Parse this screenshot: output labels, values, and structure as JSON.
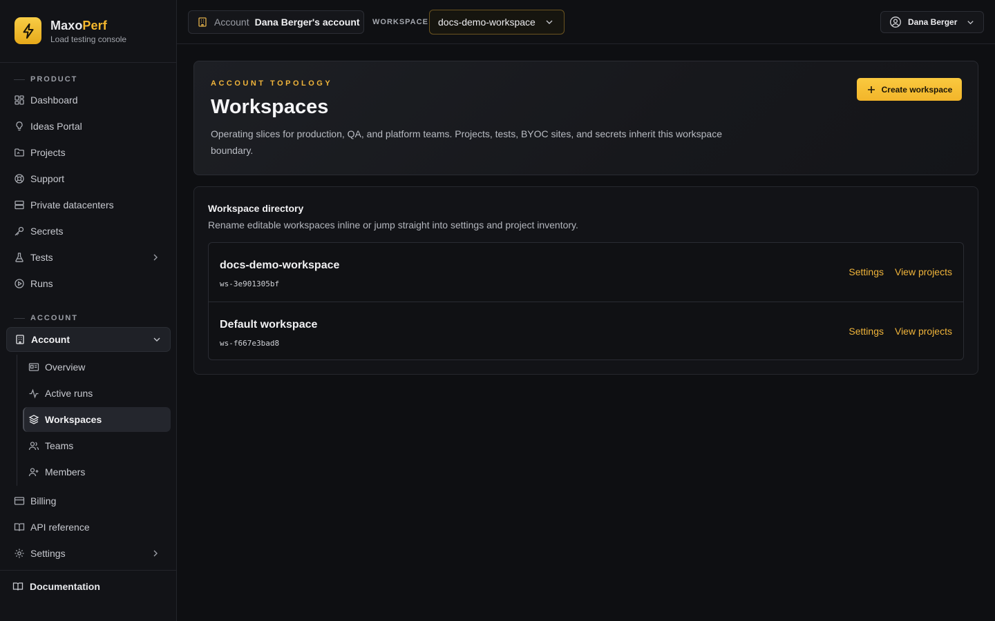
{
  "brand": {
    "name_part1": "Maxo",
    "name_part2": "Perf",
    "subtitle": "Load testing console"
  },
  "sidebar": {
    "product_label": "PRODUCT",
    "account_label": "ACCOUNT",
    "items": [
      {
        "label": "Dashboard",
        "icon": "dashboard-icon"
      },
      {
        "label": "Ideas Portal",
        "icon": "lightbulb-icon"
      },
      {
        "label": "Projects",
        "icon": "folder-icon"
      },
      {
        "label": "Support",
        "icon": "lifebuoy-icon"
      },
      {
        "label": "Private datacenters",
        "icon": "server-icon"
      },
      {
        "label": "Secrets",
        "icon": "key-icon"
      },
      {
        "label": "Tests",
        "icon": "flask-icon"
      },
      {
        "label": "Runs",
        "icon": "play-circle-icon"
      }
    ],
    "account_group": "Account",
    "account_sub": [
      {
        "label": "Overview",
        "icon": "id-card-icon"
      },
      {
        "label": "Active runs",
        "icon": "activity-icon"
      },
      {
        "label": "Workspaces",
        "icon": "layers-icon"
      },
      {
        "label": "Teams",
        "icon": "users-icon"
      },
      {
        "label": "Members",
        "icon": "user-plus-icon"
      }
    ],
    "after_items": [
      {
        "label": "Billing",
        "icon": "credit-card-icon"
      },
      {
        "label": "API reference",
        "icon": "book-icon"
      },
      {
        "label": "Settings",
        "icon": "gear-icon"
      }
    ],
    "documentation": "Documentation"
  },
  "topbar": {
    "account_prefix": "Account",
    "account_name": "Dana Berger's account",
    "workspace_label": "WORKSPACE",
    "workspace_selected": "docs-demo-workspace",
    "user_name": "Dana Berger"
  },
  "hero": {
    "eyebrow": "ACCOUNT TOPOLOGY",
    "title": "Workspaces",
    "description": "Operating slices for production, QA, and platform teams. Projects, tests, BYOC sites, and secrets inherit this workspace boundary.",
    "create_button": "Create workspace"
  },
  "directory": {
    "title": "Workspace directory",
    "description": "Rename editable workspaces inline or jump straight into settings and project inventory.",
    "rows": [
      {
        "name": "docs-demo-workspace",
        "id": "ws-3e901305bf",
        "settings": "Settings",
        "view": "View projects"
      },
      {
        "name": "Default workspace",
        "id": "ws-f667e3bad8",
        "settings": "Settings",
        "view": "View projects"
      }
    ]
  },
  "colors": {
    "accent": "#f5b82e",
    "background": "#0e0f12",
    "sidebar": "#121317"
  }
}
